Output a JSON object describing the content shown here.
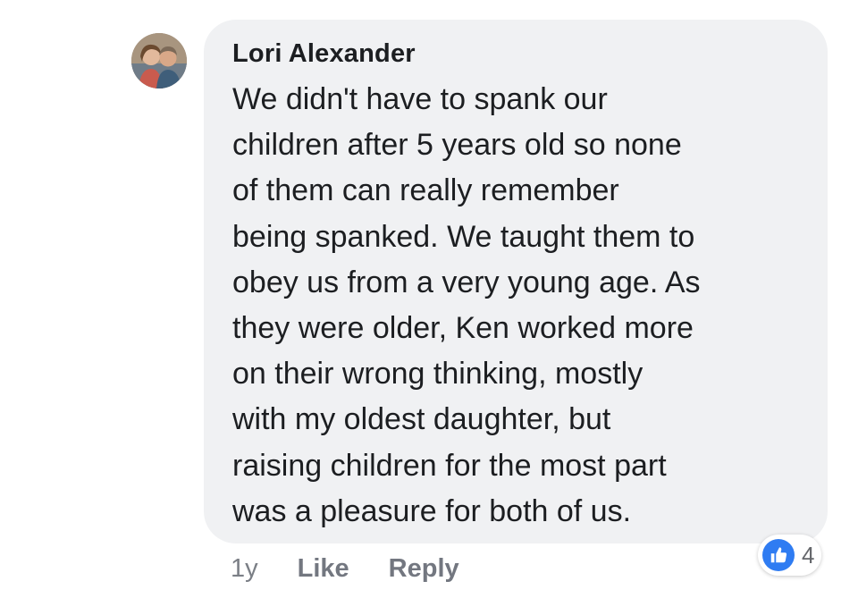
{
  "comment": {
    "author": "Lori Alexander",
    "text_lines": [
      "We didn't have to spank our",
      "children after 5 years old so none",
      "of them can really remember",
      "being spanked. We taught them to",
      "obey us from a very young age. As",
      "they were older, Ken worked more",
      "on their wrong thinking, mostly",
      "with my oldest daughter, but",
      "raising children for the most part",
      "was a pleasure for both of us."
    ],
    "timestamp": "1y",
    "like_label": "Like",
    "reply_label": "Reply",
    "reaction": {
      "icon": "thumbs-up-icon",
      "count": "4",
      "color": "#2f7cf2"
    }
  },
  "colors": {
    "bubble": "#f0f1f3",
    "text": "#1c1e21",
    "muted": "#737780"
  }
}
